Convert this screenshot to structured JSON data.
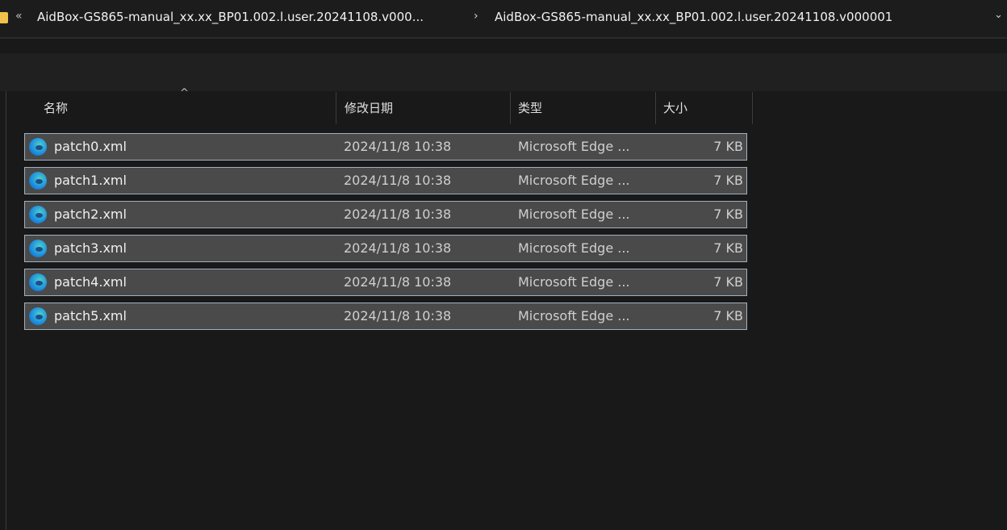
{
  "addressbar": {
    "overflow_glyph": "«",
    "crumb1": "AidBox-GS865-manual_xx.xx_BP01.002.l.user.20241108.v000...",
    "separator": "›",
    "crumb2": "AidBox-GS865-manual_xx.xx_BP01.002.l.user.20241108.v000001",
    "dropdown_glyph": "⌄"
  },
  "columns": {
    "name": "名称",
    "date": "修改日期",
    "type": "类型",
    "size": "大小",
    "sort_glyph": "^"
  },
  "files": [
    {
      "name": "patch0.xml",
      "date": "2024/11/8 10:38",
      "type": "Microsoft Edge ...",
      "size": "7 KB"
    },
    {
      "name": "patch1.xml",
      "date": "2024/11/8 10:38",
      "type": "Microsoft Edge ...",
      "size": "7 KB"
    },
    {
      "name": "patch2.xml",
      "date": "2024/11/8 10:38",
      "type": "Microsoft Edge ...",
      "size": "7 KB"
    },
    {
      "name": "patch3.xml",
      "date": "2024/11/8 10:38",
      "type": "Microsoft Edge ...",
      "size": "7 KB"
    },
    {
      "name": "patch4.xml",
      "date": "2024/11/8 10:38",
      "type": "Microsoft Edge ...",
      "size": "7 KB"
    },
    {
      "name": "patch5.xml",
      "date": "2024/11/8 10:38",
      "type": "Microsoft Edge ...",
      "size": "7 KB"
    }
  ],
  "icons": {
    "folder": "folder-icon",
    "file": "edge-icon"
  },
  "colors": {
    "selection_bg": "#4a4a4a",
    "selection_border": "#9fb1c2",
    "folder": "#f0c24c"
  }
}
